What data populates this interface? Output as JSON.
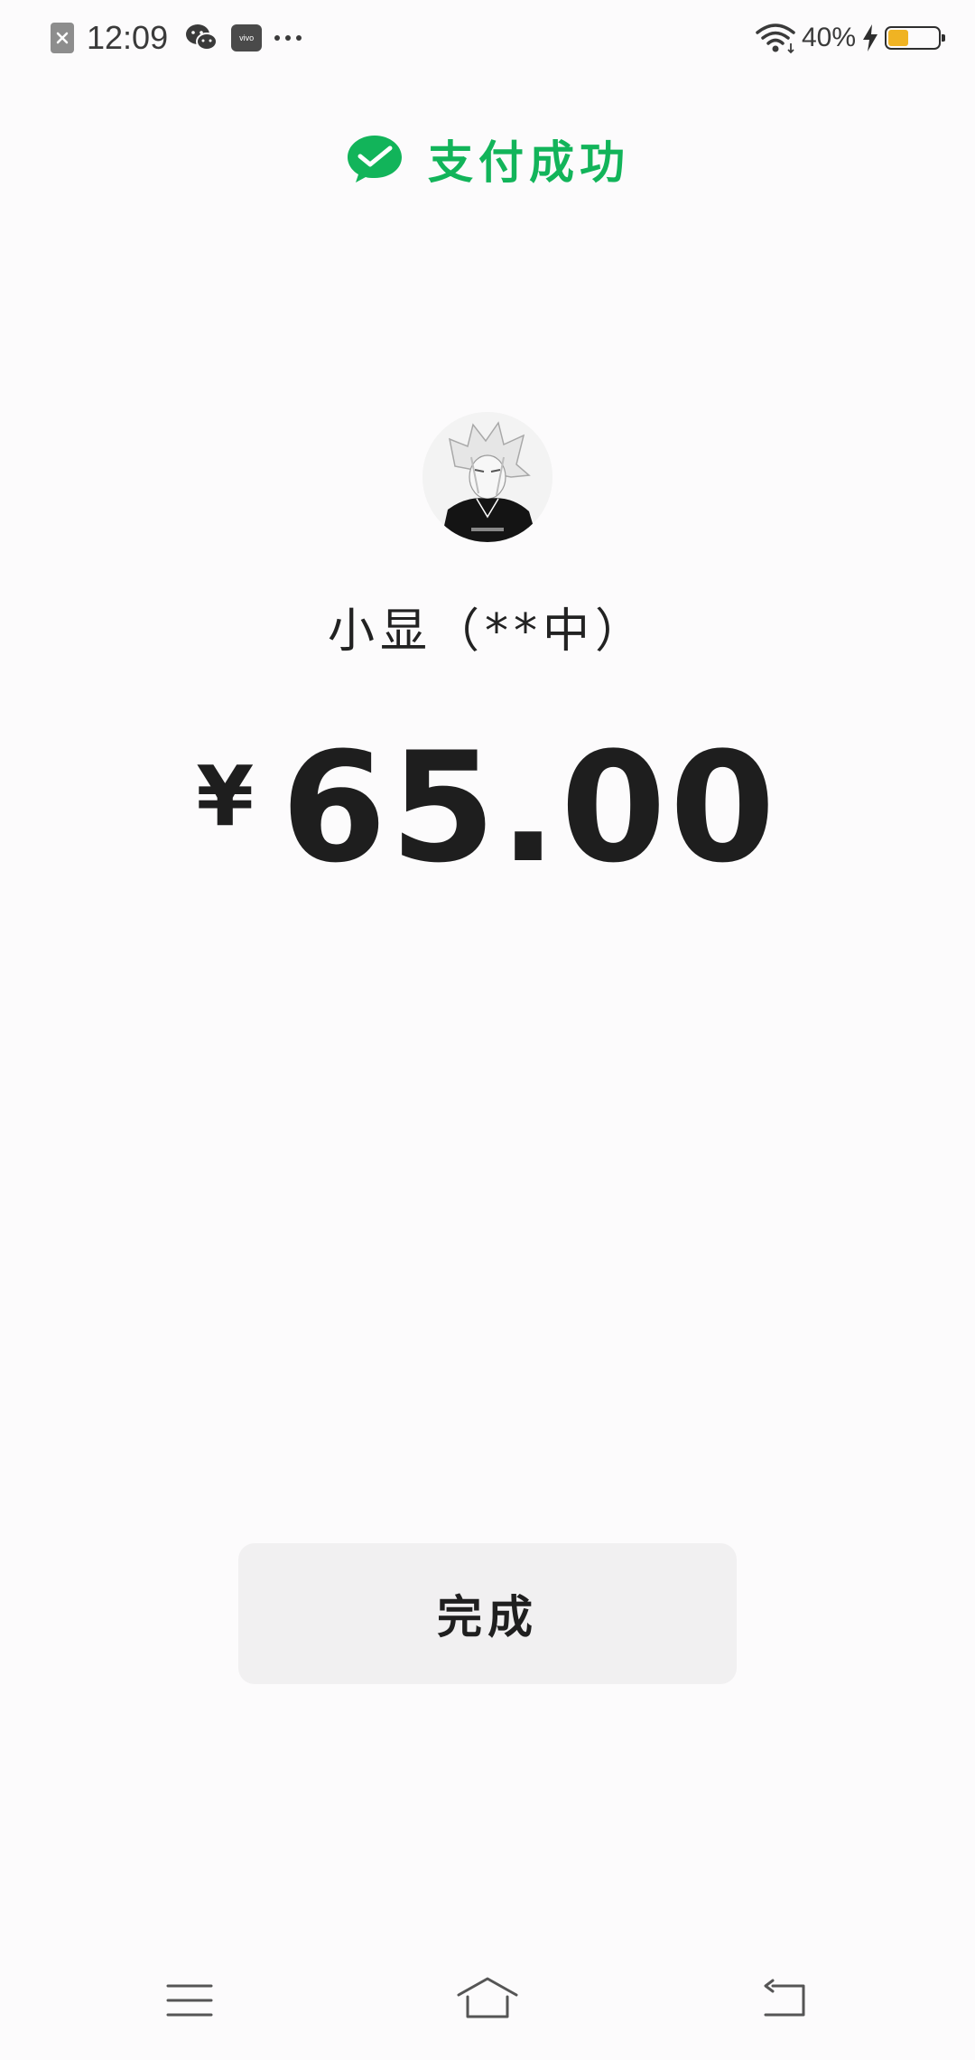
{
  "status_bar": {
    "time": "12:09",
    "battery_percent": "40%",
    "battery_level": 0.4,
    "icons": [
      "close-notification-icon",
      "wechat-icon",
      "vivo-icon",
      "more-dots-icon",
      "wifi-icon",
      "charging-icon",
      "battery-icon"
    ]
  },
  "header": {
    "title": "支付成功",
    "icon": "wechat-pay-check-icon",
    "accent_color": "#12b45a"
  },
  "payee": {
    "name": "小显（**中）"
  },
  "payment": {
    "currency_symbol": "¥",
    "amount": "65.00"
  },
  "actions": {
    "done_label": "完成"
  },
  "nav_bar": {
    "icons": [
      "menu-icon",
      "home-icon",
      "back-icon"
    ]
  }
}
